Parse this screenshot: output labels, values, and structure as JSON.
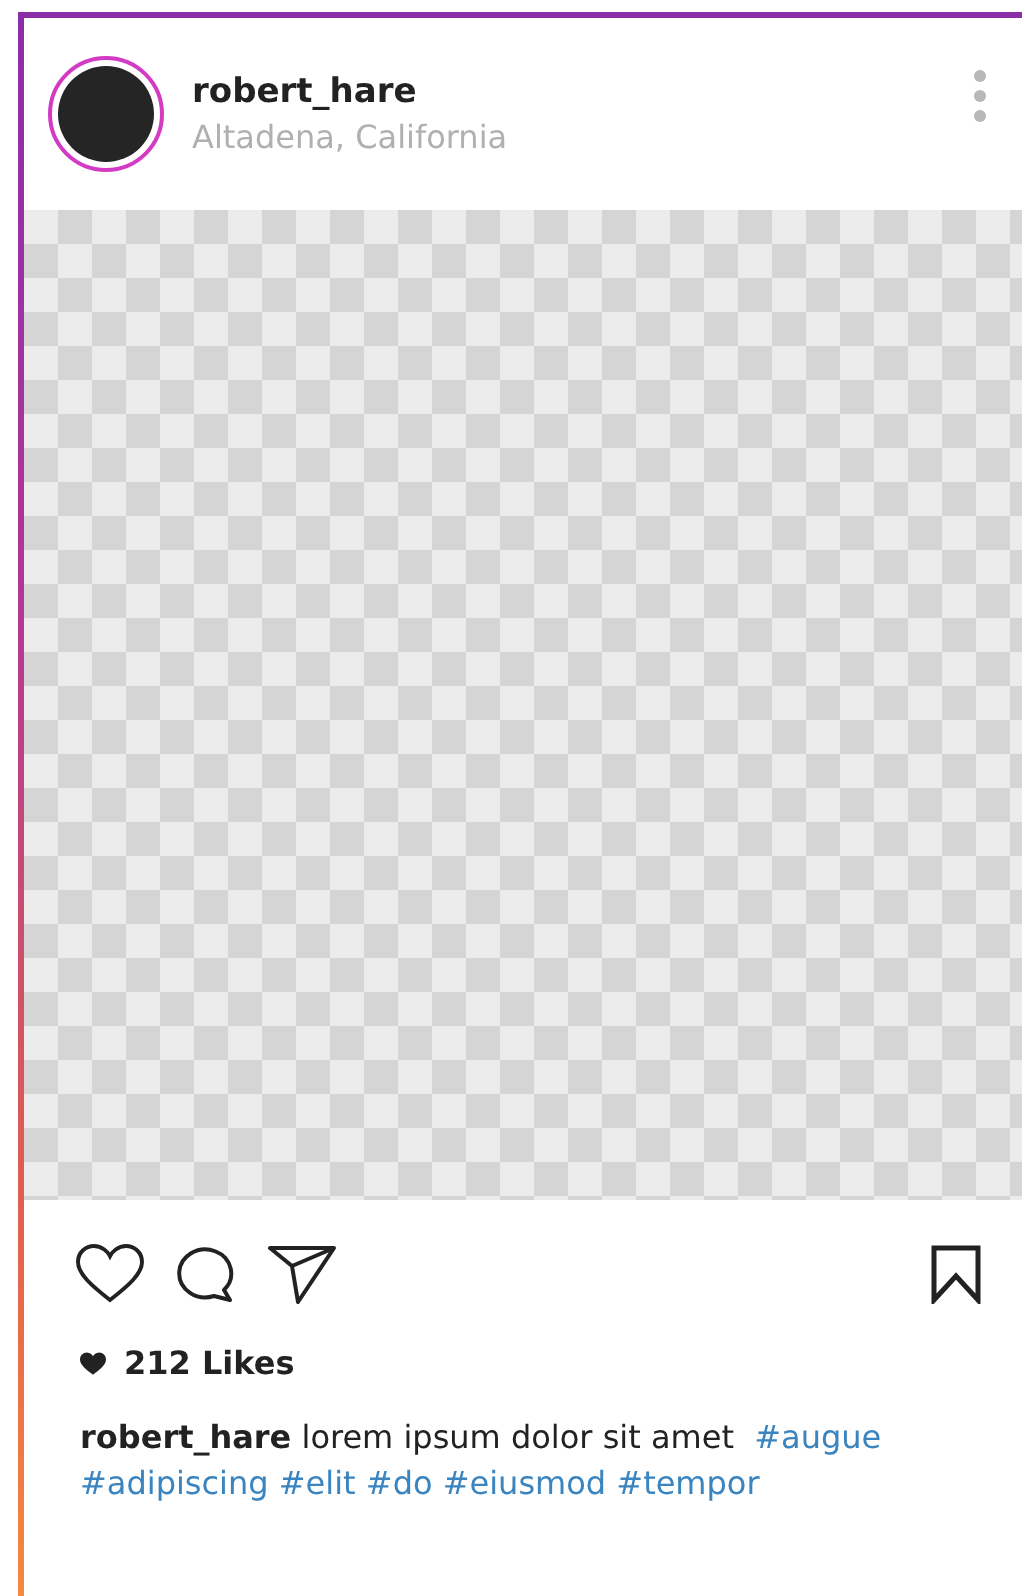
{
  "post": {
    "username": "robert_hare",
    "location": "Altadena, California"
  },
  "likes": "212 Likes",
  "caption": {
    "username": "robert_hare",
    "text": "lorem ipsum dolor sit amet",
    "hashtags": [
      "#augue",
      "#adipiscing",
      "#elit",
      "#do",
      "#eiusmod",
      "#tempor"
    ]
  }
}
